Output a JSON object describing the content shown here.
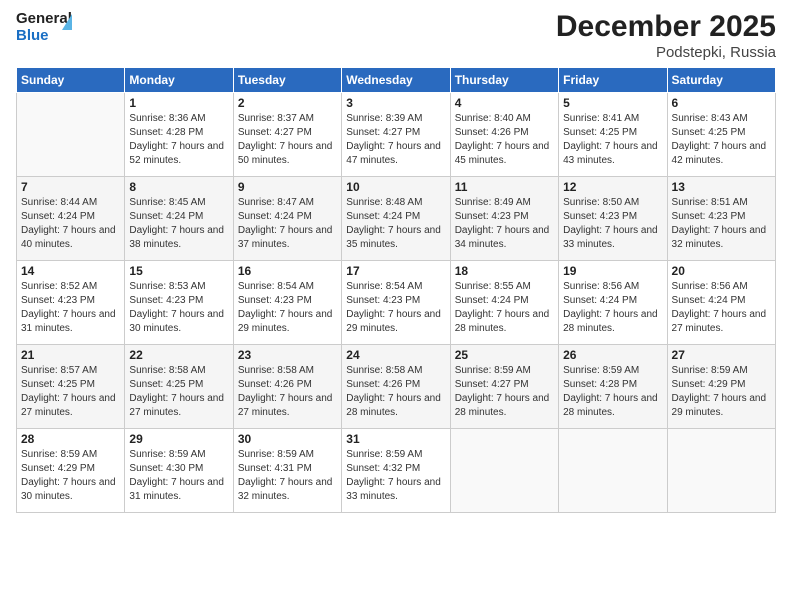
{
  "header": {
    "logo_general": "General",
    "logo_blue": "Blue",
    "month_title": "December 2025",
    "location": "Podstepki, Russia"
  },
  "days_of_week": [
    "Sunday",
    "Monday",
    "Tuesday",
    "Wednesday",
    "Thursday",
    "Friday",
    "Saturday"
  ],
  "weeks": [
    [
      {
        "day": "",
        "sunrise": "",
        "sunset": "",
        "daylight": ""
      },
      {
        "day": "1",
        "sunrise": "Sunrise: 8:36 AM",
        "sunset": "Sunset: 4:28 PM",
        "daylight": "Daylight: 7 hours and 52 minutes."
      },
      {
        "day": "2",
        "sunrise": "Sunrise: 8:37 AM",
        "sunset": "Sunset: 4:27 PM",
        "daylight": "Daylight: 7 hours and 50 minutes."
      },
      {
        "day": "3",
        "sunrise": "Sunrise: 8:39 AM",
        "sunset": "Sunset: 4:27 PM",
        "daylight": "Daylight: 7 hours and 47 minutes."
      },
      {
        "day": "4",
        "sunrise": "Sunrise: 8:40 AM",
        "sunset": "Sunset: 4:26 PM",
        "daylight": "Daylight: 7 hours and 45 minutes."
      },
      {
        "day": "5",
        "sunrise": "Sunrise: 8:41 AM",
        "sunset": "Sunset: 4:25 PM",
        "daylight": "Daylight: 7 hours and 43 minutes."
      },
      {
        "day": "6",
        "sunrise": "Sunrise: 8:43 AM",
        "sunset": "Sunset: 4:25 PM",
        "daylight": "Daylight: 7 hours and 42 minutes."
      }
    ],
    [
      {
        "day": "7",
        "sunrise": "Sunrise: 8:44 AM",
        "sunset": "Sunset: 4:24 PM",
        "daylight": "Daylight: 7 hours and 40 minutes."
      },
      {
        "day": "8",
        "sunrise": "Sunrise: 8:45 AM",
        "sunset": "Sunset: 4:24 PM",
        "daylight": "Daylight: 7 hours and 38 minutes."
      },
      {
        "day": "9",
        "sunrise": "Sunrise: 8:47 AM",
        "sunset": "Sunset: 4:24 PM",
        "daylight": "Daylight: 7 hours and 37 minutes."
      },
      {
        "day": "10",
        "sunrise": "Sunrise: 8:48 AM",
        "sunset": "Sunset: 4:24 PM",
        "daylight": "Daylight: 7 hours and 35 minutes."
      },
      {
        "day": "11",
        "sunrise": "Sunrise: 8:49 AM",
        "sunset": "Sunset: 4:23 PM",
        "daylight": "Daylight: 7 hours and 34 minutes."
      },
      {
        "day": "12",
        "sunrise": "Sunrise: 8:50 AM",
        "sunset": "Sunset: 4:23 PM",
        "daylight": "Daylight: 7 hours and 33 minutes."
      },
      {
        "day": "13",
        "sunrise": "Sunrise: 8:51 AM",
        "sunset": "Sunset: 4:23 PM",
        "daylight": "Daylight: 7 hours and 32 minutes."
      }
    ],
    [
      {
        "day": "14",
        "sunrise": "Sunrise: 8:52 AM",
        "sunset": "Sunset: 4:23 PM",
        "daylight": "Daylight: 7 hours and 31 minutes."
      },
      {
        "day": "15",
        "sunrise": "Sunrise: 8:53 AM",
        "sunset": "Sunset: 4:23 PM",
        "daylight": "Daylight: 7 hours and 30 minutes."
      },
      {
        "day": "16",
        "sunrise": "Sunrise: 8:54 AM",
        "sunset": "Sunset: 4:23 PM",
        "daylight": "Daylight: 7 hours and 29 minutes."
      },
      {
        "day": "17",
        "sunrise": "Sunrise: 8:54 AM",
        "sunset": "Sunset: 4:23 PM",
        "daylight": "Daylight: 7 hours and 29 minutes."
      },
      {
        "day": "18",
        "sunrise": "Sunrise: 8:55 AM",
        "sunset": "Sunset: 4:24 PM",
        "daylight": "Daylight: 7 hours and 28 minutes."
      },
      {
        "day": "19",
        "sunrise": "Sunrise: 8:56 AM",
        "sunset": "Sunset: 4:24 PM",
        "daylight": "Daylight: 7 hours and 28 minutes."
      },
      {
        "day": "20",
        "sunrise": "Sunrise: 8:56 AM",
        "sunset": "Sunset: 4:24 PM",
        "daylight": "Daylight: 7 hours and 27 minutes."
      }
    ],
    [
      {
        "day": "21",
        "sunrise": "Sunrise: 8:57 AM",
        "sunset": "Sunset: 4:25 PM",
        "daylight": "Daylight: 7 hours and 27 minutes."
      },
      {
        "day": "22",
        "sunrise": "Sunrise: 8:58 AM",
        "sunset": "Sunset: 4:25 PM",
        "daylight": "Daylight: 7 hours and 27 minutes."
      },
      {
        "day": "23",
        "sunrise": "Sunrise: 8:58 AM",
        "sunset": "Sunset: 4:26 PM",
        "daylight": "Daylight: 7 hours and 27 minutes."
      },
      {
        "day": "24",
        "sunrise": "Sunrise: 8:58 AM",
        "sunset": "Sunset: 4:26 PM",
        "daylight": "Daylight: 7 hours and 28 minutes."
      },
      {
        "day": "25",
        "sunrise": "Sunrise: 8:59 AM",
        "sunset": "Sunset: 4:27 PM",
        "daylight": "Daylight: 7 hours and 28 minutes."
      },
      {
        "day": "26",
        "sunrise": "Sunrise: 8:59 AM",
        "sunset": "Sunset: 4:28 PM",
        "daylight": "Daylight: 7 hours and 28 minutes."
      },
      {
        "day": "27",
        "sunrise": "Sunrise: 8:59 AM",
        "sunset": "Sunset: 4:29 PM",
        "daylight": "Daylight: 7 hours and 29 minutes."
      }
    ],
    [
      {
        "day": "28",
        "sunrise": "Sunrise: 8:59 AM",
        "sunset": "Sunset: 4:29 PM",
        "daylight": "Daylight: 7 hours and 30 minutes."
      },
      {
        "day": "29",
        "sunrise": "Sunrise: 8:59 AM",
        "sunset": "Sunset: 4:30 PM",
        "daylight": "Daylight: 7 hours and 31 minutes."
      },
      {
        "day": "30",
        "sunrise": "Sunrise: 8:59 AM",
        "sunset": "Sunset: 4:31 PM",
        "daylight": "Daylight: 7 hours and 32 minutes."
      },
      {
        "day": "31",
        "sunrise": "Sunrise: 8:59 AM",
        "sunset": "Sunset: 4:32 PM",
        "daylight": "Daylight: 7 hours and 33 minutes."
      },
      {
        "day": "",
        "sunrise": "",
        "sunset": "",
        "daylight": ""
      },
      {
        "day": "",
        "sunrise": "",
        "sunset": "",
        "daylight": ""
      },
      {
        "day": "",
        "sunrise": "",
        "sunset": "",
        "daylight": ""
      }
    ]
  ]
}
